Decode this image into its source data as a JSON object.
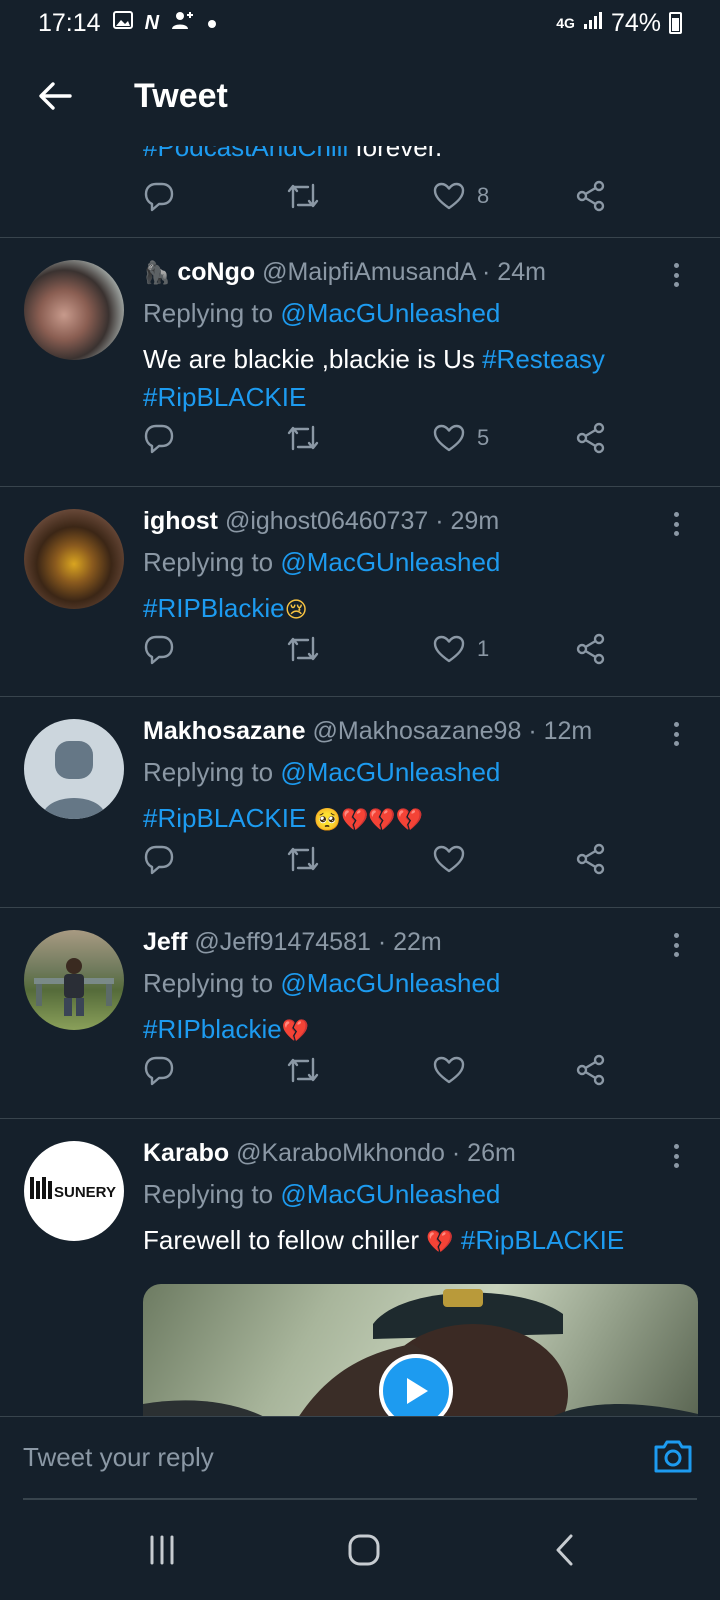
{
  "status_bar": {
    "time": "17:14",
    "network": "4G",
    "battery": "74%",
    "icons": [
      "gallery-icon",
      "n-icon",
      "add-contact-icon",
      "dot-icon",
      "signal-icon",
      "battery-icon"
    ]
  },
  "header": {
    "title": "Tweet"
  },
  "cut_tweet": {
    "text_tag": "#PodcastAndChill",
    "text_rest": " forever.",
    "like_count": "8"
  },
  "tweets": [
    {
      "name": "coNgo",
      "name_prefix": "🦍",
      "handle": "@MaipfiAmusandA",
      "time": "· 24m",
      "replying_label": "Replying to",
      "replying_to": "@MacGUnleashed",
      "text_plain": "We are blackie ,blackie is Us ",
      "tag1": "#Resteasy",
      "tag2": "#RipBLACKIE",
      "like_count": "5"
    },
    {
      "name": "ighost",
      "handle": "@ighost06460737",
      "time": "· 29m",
      "replying_label": "Replying to",
      "replying_to": "@MacGUnleashed",
      "tag1": "#RIPBlackie",
      "emoji": "😢",
      "like_count": "1"
    },
    {
      "name": "Makhosazane",
      "handle": "@Makhosazane98",
      "time": "· 12m",
      "replying_label": "Replying to",
      "replying_to": "@MacGUnleashed",
      "tag1": "#RipBLACKIE",
      "emoji_face": "🥺",
      "emoji_hearts": "💔💔💔",
      "like_count": ""
    },
    {
      "name": "Jeff",
      "handle": "@Jeff91474581",
      "time": "· 22m",
      "replying_label": "Replying to",
      "replying_to": "@MacGUnleashed",
      "tag1": "#RIPblackie",
      "emoji_hearts": "💔",
      "like_count": ""
    },
    {
      "name": "Karabo",
      "handle": "@KaraboMkhondo",
      "time": "· 26m",
      "replying_label": "Replying to",
      "replying_to": "@MacGUnleashed",
      "text_plain": "Farewell to fellow chiller ",
      "emoji_hearts": "💔",
      "tag1": "#RipBLACKIE",
      "avatar_logo": "SUNERY"
    }
  ],
  "reply_bar": {
    "placeholder": "Tweet your reply"
  },
  "colors": {
    "background": "#15202b",
    "accent": "#1d9bf0",
    "muted": "#8b98a5",
    "divider": "#38444d"
  }
}
